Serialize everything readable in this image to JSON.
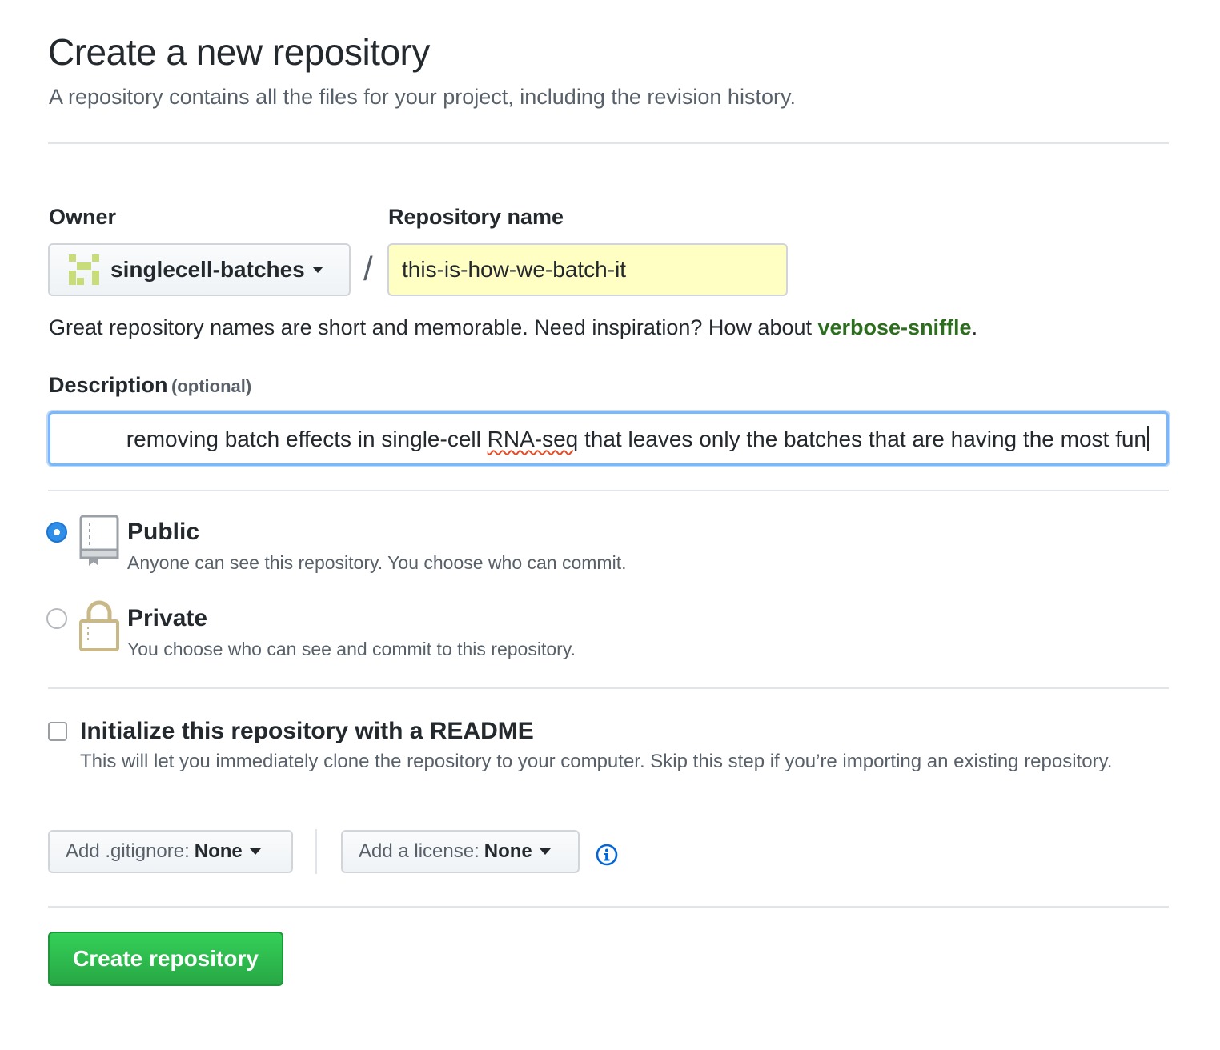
{
  "header": {
    "title": "Create a new repository",
    "subtitle": "A repository contains all the files for your project, including the revision history."
  },
  "owner": {
    "label": "Owner",
    "value": "singlecell-batches",
    "avatar_icon": "identicon-avatar"
  },
  "separator": "/",
  "repo_name": {
    "label": "Repository name",
    "value": "this-is-how-we-batch-it"
  },
  "name_hint": {
    "text": "Great repository names are short and memorable. Need inspiration? How about ",
    "suggestion": "verbose-sniffle",
    "end": "."
  },
  "description": {
    "label": "Description",
    "optional": "(optional)",
    "visible_before": "removing batch effects in single-cell ",
    "spellcheck_word": "RNA-seq",
    "visible_after": " that leaves only the batches that are having the most fun"
  },
  "visibility": {
    "public": {
      "title": "Public",
      "desc": "Anyone can see this repository. You choose who can commit.",
      "selected": true,
      "icon": "repo-book-icon"
    },
    "private": {
      "title": "Private",
      "desc": "You choose who can see and commit to this repository.",
      "selected": false,
      "icon": "lock-icon"
    }
  },
  "readme": {
    "title": "Initialize this repository with a README",
    "desc": "This will let you immediately clone the repository to your computer. Skip this step if you’re importing an existing repository.",
    "checked": false
  },
  "gitignore": {
    "prefix": "Add .gitignore:",
    "value": "None"
  },
  "license": {
    "prefix": "Add a license:",
    "value": "None"
  },
  "info_icon": "info-icon",
  "submit": {
    "label": "Create repository"
  },
  "colors": {
    "accent_blue": "#2f8ee8",
    "suggestion_green": "#2c6e1e",
    "create_green": "#28a745",
    "repo_name_bg": "#ffffc4"
  }
}
